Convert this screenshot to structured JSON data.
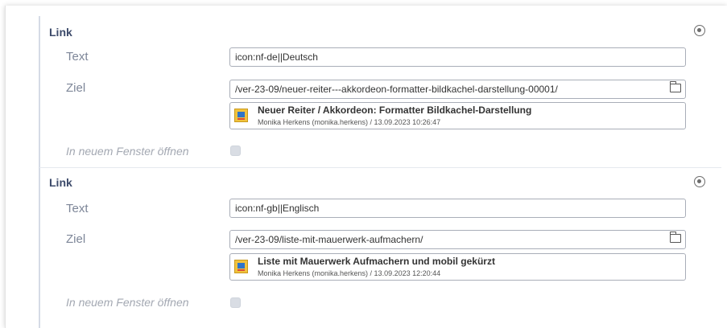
{
  "links": [
    {
      "title": "Link",
      "text_label": "Text",
      "text_value": "icon:nf-de||Deutsch",
      "ziel_label": "Ziel",
      "ziel_value": "/ver-23-09/neuer-reiter---akkordeon-formatter-bildkachel-darstellung-00001/",
      "ref_title": "Neuer Reiter / Akkordeon: Formatter Bildkachel-Darstellung",
      "ref_meta": "Monika Herkens (monika.herkens) / 13.09.2023 10:26:47",
      "new_window_label": "In neuem Fenster öffnen",
      "new_window_checked": false
    },
    {
      "title": "Link",
      "text_label": "Text",
      "text_value": "icon:nf-gb||Englisch",
      "ziel_label": "Ziel",
      "ziel_value": "/ver-23-09/liste-mit-mauerwerk-aufmachern/",
      "ref_title": "Liste mit Mauerwerk Aufmachern und mobil gekürzt",
      "ref_meta": "Monika Herkens (monika.herkens) / 13.09.2023 12:20:44",
      "new_window_label": "In neuem Fenster öffnen",
      "new_window_checked": false
    }
  ]
}
